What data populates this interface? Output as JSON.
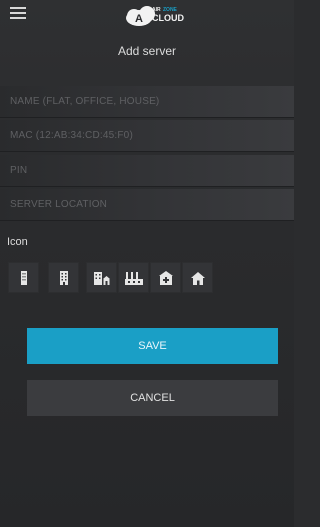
{
  "header": {
    "menu_icon": "hamburger-menu-icon",
    "logo": {
      "mark": "A",
      "line1": "AIR",
      "line2": "ZONE",
      "line3": "CLOUD",
      "accent_color": "#1a9fc6"
    }
  },
  "page": {
    "title": "Add server"
  },
  "form": {
    "fields": [
      {
        "name": "name",
        "placeholder": "NAME (FLAT, OFFICE, HOUSE)",
        "value": ""
      },
      {
        "name": "mac",
        "placeholder": "MAC (12:AB:34:CD:45:F0)",
        "value": ""
      },
      {
        "name": "pin",
        "placeholder": "PIN",
        "value": ""
      },
      {
        "name": "location",
        "placeholder": "SERVER LOCATION",
        "value": ""
      }
    ],
    "icon_label": "Icon",
    "icons": [
      "single-building-icon",
      "office-tower-icon",
      "building-with-house-icon",
      "factory-icon",
      "hospital-icon",
      "house-icon"
    ]
  },
  "actions": {
    "save_label": "SAVE",
    "cancel_label": "CANCEL",
    "save_color": "#1a9fc6",
    "cancel_color": "#3b3c3f"
  }
}
